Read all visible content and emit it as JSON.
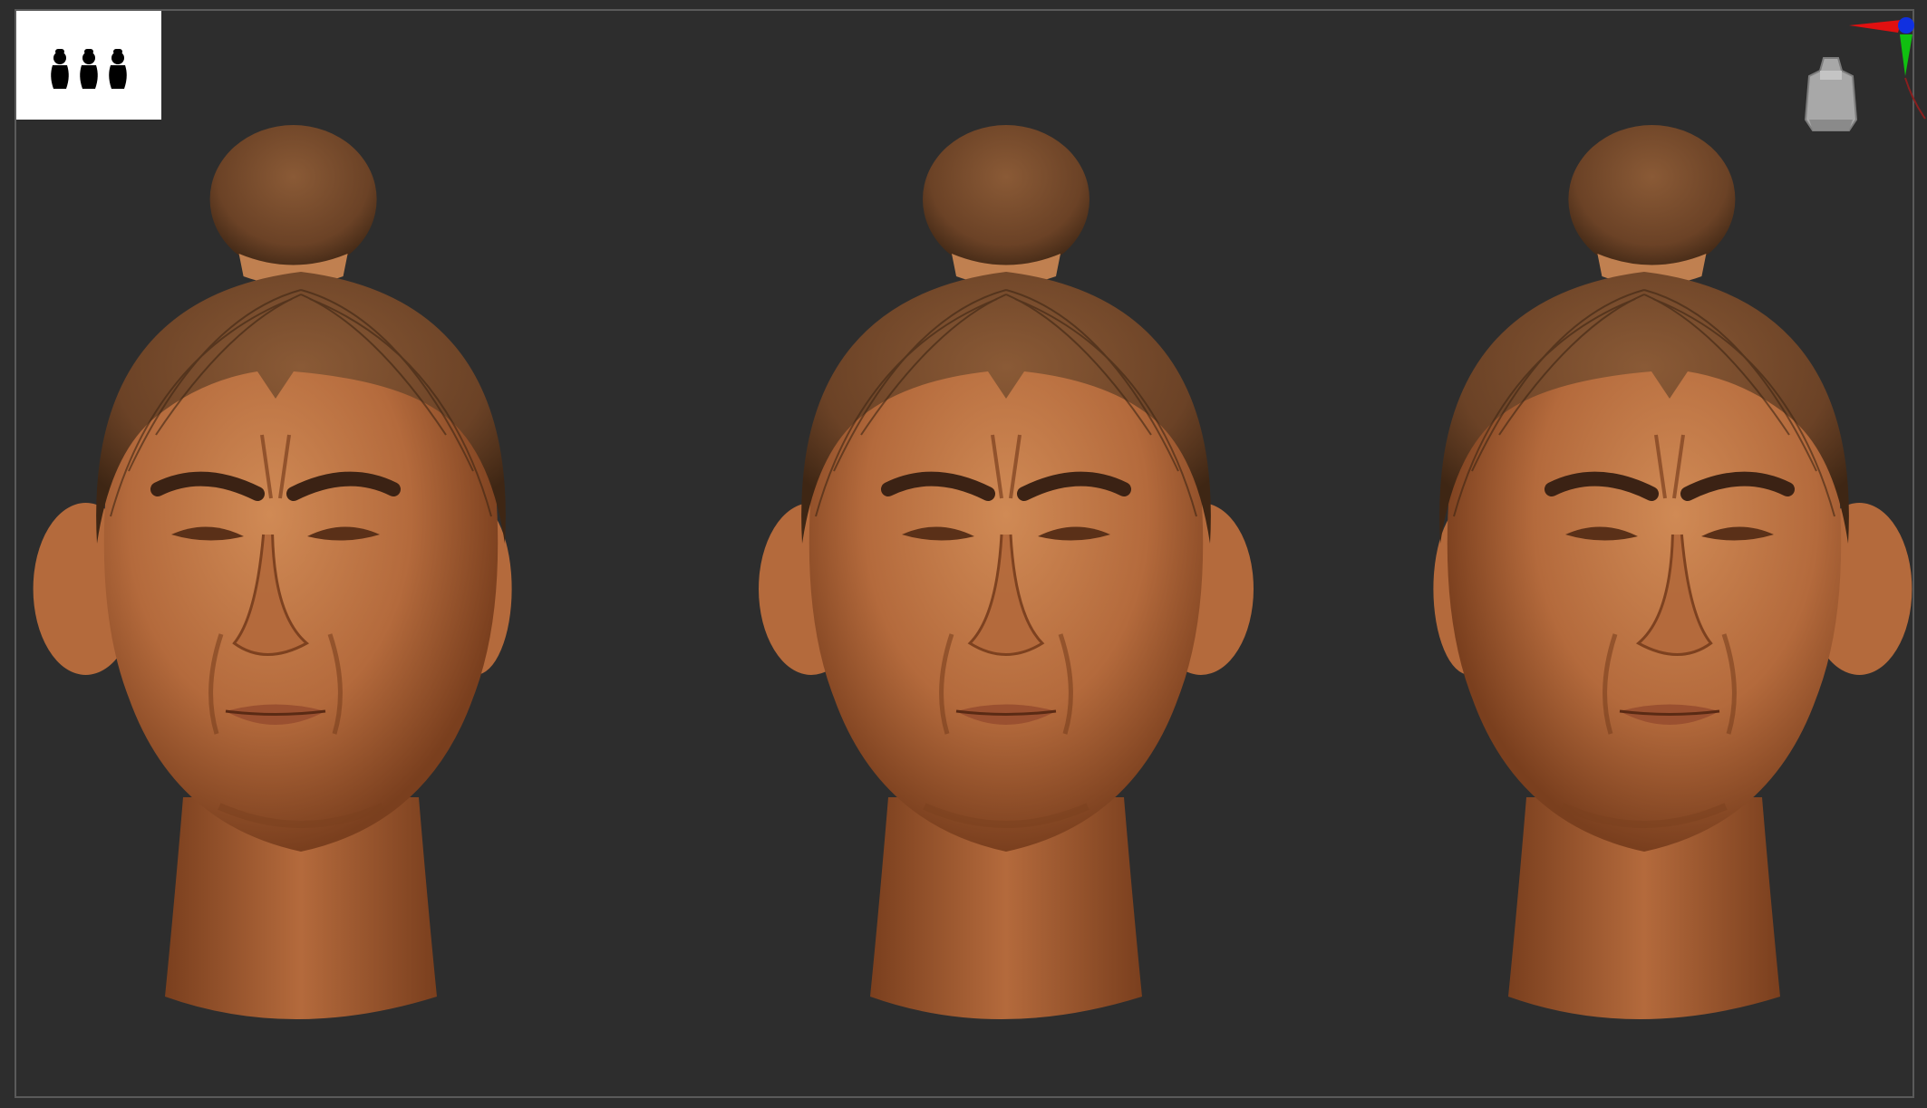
{
  "app": {
    "type": "3d-sculpting-viewport",
    "background_color": "#2d2d2d",
    "frame_color": "#5a5a5a"
  },
  "thumbnail": {
    "icon": "three-heads-silhouette-icon",
    "background": "#ffffff"
  },
  "gizmo": {
    "axes": [
      {
        "axis": "x",
        "color": "#e01010"
      },
      {
        "axis": "y",
        "color": "#10c010"
      },
      {
        "axis": "z",
        "color": "#1030e0"
      }
    ]
  },
  "viewcube": {
    "icon": "head-viewcube-icon",
    "color": "#a8a8a8"
  },
  "views": [
    {
      "name": "three-quarter-left",
      "turn": -1
    },
    {
      "name": "front",
      "turn": 0
    },
    {
      "name": "three-quarter-right",
      "turn": 1
    }
  ],
  "material": {
    "skin": "#b46a3c",
    "skin_shadow": "#7a3f1e",
    "skin_highlight": "#d08a55",
    "hair": "#6b4226",
    "hair_dark": "#3e2614"
  }
}
